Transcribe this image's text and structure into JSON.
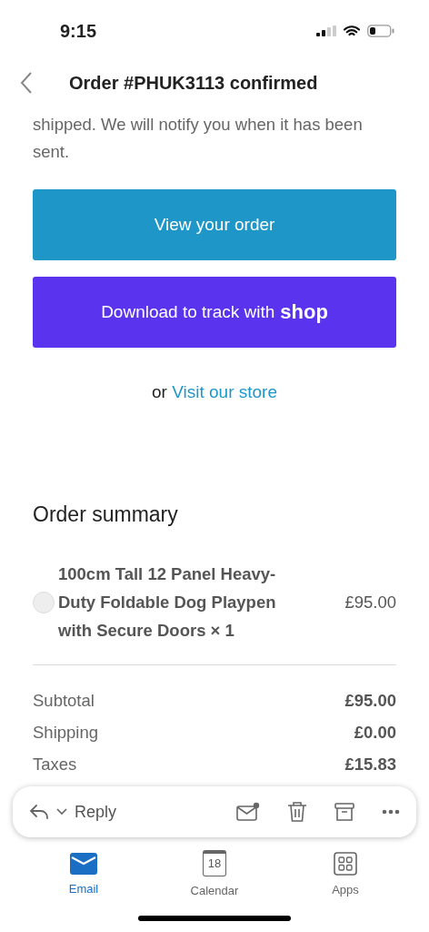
{
  "status_bar": {
    "time": "9:15"
  },
  "header": {
    "title": "Order #PHUK3113 confirmed"
  },
  "body": {
    "intro": "shipped. We will notify you when it has been sent.",
    "primary_button": "View your order",
    "shop_button": {
      "label": "Download to track with",
      "logo": "shop"
    },
    "store_line": {
      "prefix": "or",
      "link": "Visit our store"
    }
  },
  "order_summary": {
    "heading": "Order summary",
    "items": [
      {
        "name": "100cm Tall 12 Panel Heavy-Duty Foldable Dog Playpen with Secure Doors × 1",
        "price": "£95.00"
      }
    ],
    "totals": [
      {
        "label": "Subtotal",
        "value": "£95.00"
      },
      {
        "label": "Shipping",
        "value": "£0.00"
      },
      {
        "label": "Taxes",
        "value": "£15.83"
      }
    ]
  },
  "toolbar": {
    "reply": "Reply"
  },
  "tab_bar": [
    {
      "label": "Email",
      "kind": "email",
      "selected": true
    },
    {
      "label": "Calendar",
      "kind": "calendar",
      "day": "18",
      "selected": false
    },
    {
      "label": "Apps",
      "kind": "apps",
      "selected": false
    }
  ]
}
